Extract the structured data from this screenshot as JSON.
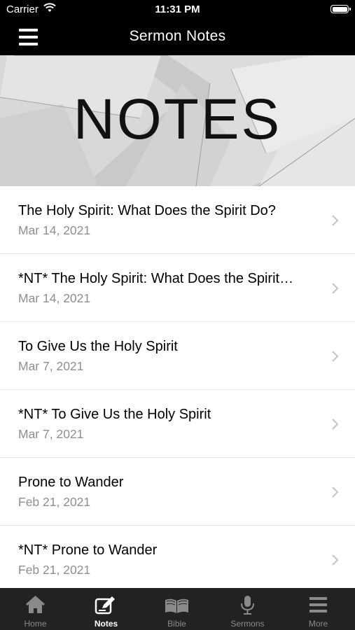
{
  "status_bar": {
    "carrier": "Carrier",
    "time": "11:31 PM"
  },
  "navbar": {
    "title": "Sermon Notes",
    "menu_icon": "hamburger-menu-icon"
  },
  "hero": {
    "text": "NOTES"
  },
  "notes": [
    {
      "title": "The Holy Spirit:  What Does the Spirit Do?",
      "date": "Mar 14, 2021"
    },
    {
      "title": "*NT* The Holy Spirit:  What Does the Spirit…",
      "date": "Mar 14, 2021"
    },
    {
      "title": "To Give Us the Holy Spirit",
      "date": "Mar 7, 2021"
    },
    {
      "title": "*NT* To Give Us the Holy Spirit",
      "date": "Mar 7, 2021"
    },
    {
      "title": "Prone to Wander",
      "date": "Feb 21, 2021"
    },
    {
      "title": "*NT* Prone to Wander",
      "date": "Feb 21, 2021"
    }
  ],
  "tabbar": {
    "tabs": [
      {
        "label": "Home",
        "icon": "home-icon"
      },
      {
        "label": "Notes",
        "icon": "notes-edit-icon",
        "active": true
      },
      {
        "label": "Bible",
        "icon": "bible-book-icon"
      },
      {
        "label": "Sermons",
        "icon": "microphone-icon"
      },
      {
        "label": "More",
        "icon": "more-menu-icon"
      }
    ]
  },
  "colors": {
    "bar_bg": "#000000",
    "tabbar_bg": "#222222",
    "tab_inactive": "#8a8a8a",
    "tab_active": "#ffffff",
    "date_gray": "#8e8e93"
  }
}
